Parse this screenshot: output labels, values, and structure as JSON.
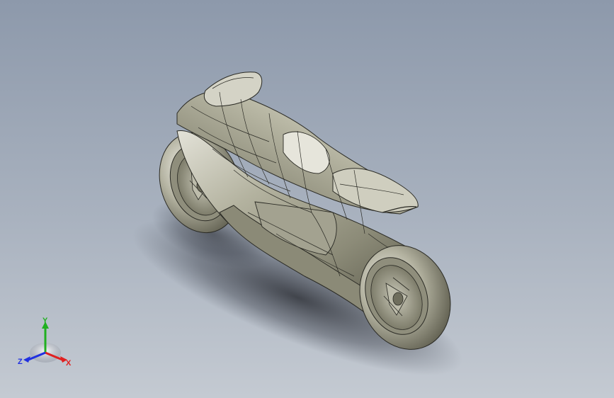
{
  "viewport": {
    "background_top": "#8d99ab",
    "background_bottom": "#c4cad2",
    "model_color": "#a8a795",
    "edge_color": "#2a2a24"
  },
  "triad": {
    "x_label": "X",
    "y_label": "Y",
    "z_label": "Z",
    "x_color": "#e02020",
    "y_color": "#20b020",
    "z_color": "#2030e0"
  }
}
